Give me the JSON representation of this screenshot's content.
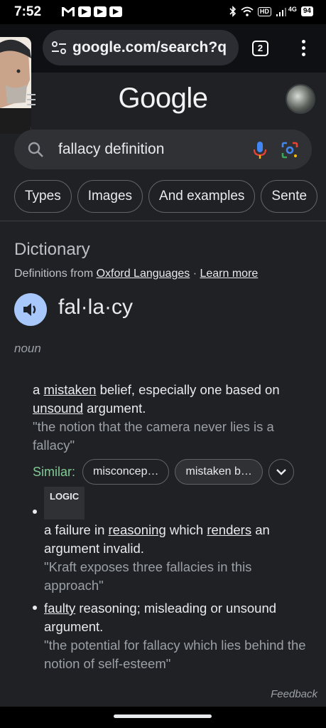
{
  "status_bar": {
    "time": "7:52",
    "left_icons": [
      "gmail-icon",
      "youtube-icon",
      "youtube-icon",
      "youtube-icon"
    ],
    "hd_badge": "HD",
    "network": "4G",
    "battery": "94"
  },
  "browser": {
    "url": "google.com/search?q",
    "tab_count": "2"
  },
  "header": {
    "logo": "Google"
  },
  "search": {
    "query": "fallacy definition"
  },
  "chips": [
    "Types",
    "Images",
    "And examples",
    "Sente"
  ],
  "dictionary": {
    "title": "Dictionary",
    "defs_prefix": "Definitions from ",
    "source": "Oxford Languages",
    "separator": " · ",
    "learn_more": "Learn more",
    "headword": "fal·la·cy",
    "part_of_speech": "noun",
    "definition1": {
      "parts": [
        "a ",
        "mistaken",
        " belief, especially one based on ",
        "unsound",
        " argument."
      ],
      "example": "\"the notion that the camera never lies is a fallacy\""
    },
    "similar": {
      "label": "Similar:",
      "chips": [
        "misconcep…",
        "mistaken b…"
      ]
    },
    "logic_label": "LOGIC",
    "definition2": {
      "parts": [
        "a failure in ",
        "reasoning",
        " which ",
        "renders",
        " an argument invalid."
      ],
      "example": "\"Kraft exposes three fallacies in this approach\""
    },
    "definition3": {
      "parts": [
        "faulty",
        " reasoning; misleading or unsound argument."
      ],
      "example": "\"the potential for fallacy which lies behind the notion of self-esteem\""
    },
    "feedback": "Feedback"
  },
  "colors": {
    "background": "#202124",
    "speaker_button": "#a8c7fa",
    "similar_label": "#81c995"
  }
}
